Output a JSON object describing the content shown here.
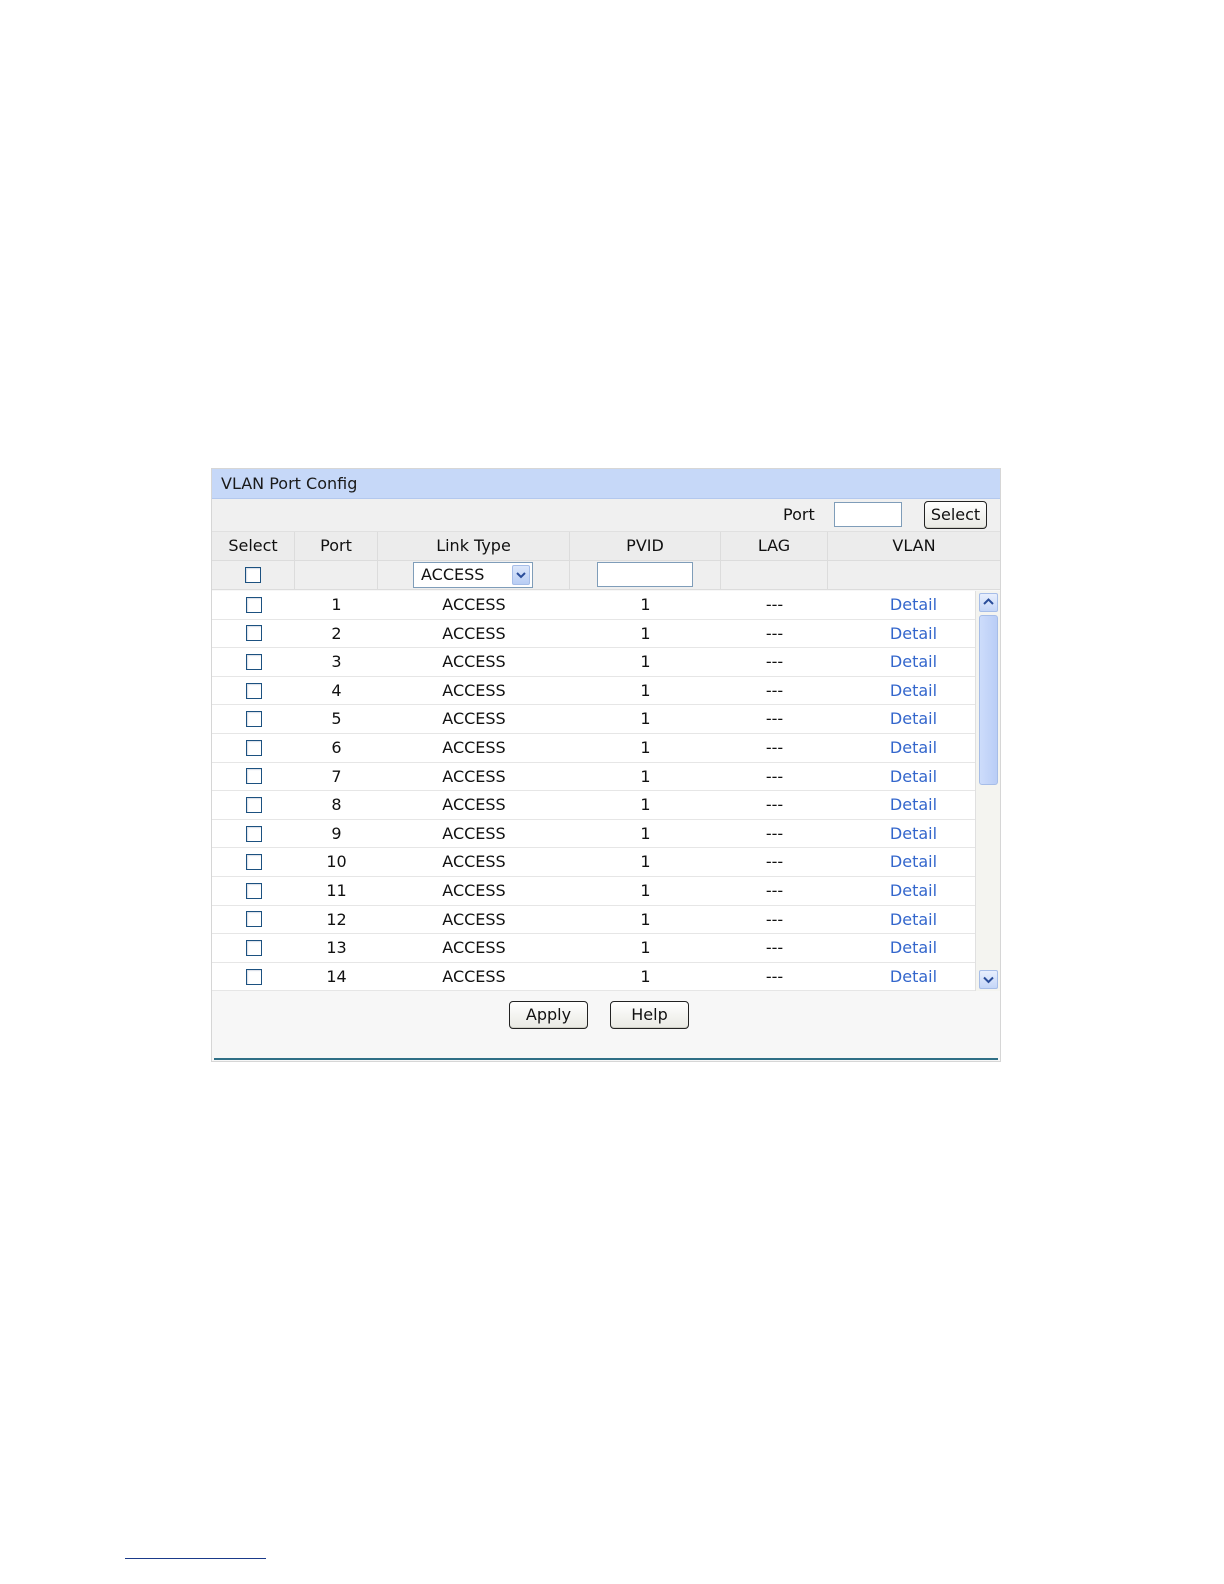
{
  "panel": {
    "title": "VLAN Port Config",
    "port_label": "Port",
    "port_value": "",
    "select_button": "Select",
    "apply_button": "Apply",
    "help_button": "Help"
  },
  "table": {
    "headers": [
      "Select",
      "Port",
      "Link Type",
      "PVID",
      "LAG",
      "VLAN"
    ],
    "filter": {
      "link_type": "ACCESS",
      "pvid": ""
    },
    "rows": [
      {
        "port": "1",
        "link_type": "ACCESS",
        "pvid": "1",
        "lag": "---",
        "vlan": "Detail"
      },
      {
        "port": "2",
        "link_type": "ACCESS",
        "pvid": "1",
        "lag": "---",
        "vlan": "Detail"
      },
      {
        "port": "3",
        "link_type": "ACCESS",
        "pvid": "1",
        "lag": "---",
        "vlan": "Detail"
      },
      {
        "port": "4",
        "link_type": "ACCESS",
        "pvid": "1",
        "lag": "---",
        "vlan": "Detail"
      },
      {
        "port": "5",
        "link_type": "ACCESS",
        "pvid": "1",
        "lag": "---",
        "vlan": "Detail"
      },
      {
        "port": "6",
        "link_type": "ACCESS",
        "pvid": "1",
        "lag": "---",
        "vlan": "Detail"
      },
      {
        "port": "7",
        "link_type": "ACCESS",
        "pvid": "1",
        "lag": "---",
        "vlan": "Detail"
      },
      {
        "port": "8",
        "link_type": "ACCESS",
        "pvid": "1",
        "lag": "---",
        "vlan": "Detail"
      },
      {
        "port": "9",
        "link_type": "ACCESS",
        "pvid": "1",
        "lag": "---",
        "vlan": "Detail"
      },
      {
        "port": "10",
        "link_type": "ACCESS",
        "pvid": "1",
        "lag": "---",
        "vlan": "Detail"
      },
      {
        "port": "11",
        "link_type": "ACCESS",
        "pvid": "1",
        "lag": "---",
        "vlan": "Detail"
      },
      {
        "port": "12",
        "link_type": "ACCESS",
        "pvid": "1",
        "lag": "---",
        "vlan": "Detail"
      },
      {
        "port": "13",
        "link_type": "ACCESS",
        "pvid": "1",
        "lag": "---",
        "vlan": "Detail"
      },
      {
        "port": "14",
        "link_type": "ACCESS",
        "pvid": "1",
        "lag": "---",
        "vlan": "Detail"
      }
    ]
  },
  "colors": {
    "title_bar": "#c6d8f8",
    "link": "#3366cc",
    "divider": "#2f6f86"
  }
}
